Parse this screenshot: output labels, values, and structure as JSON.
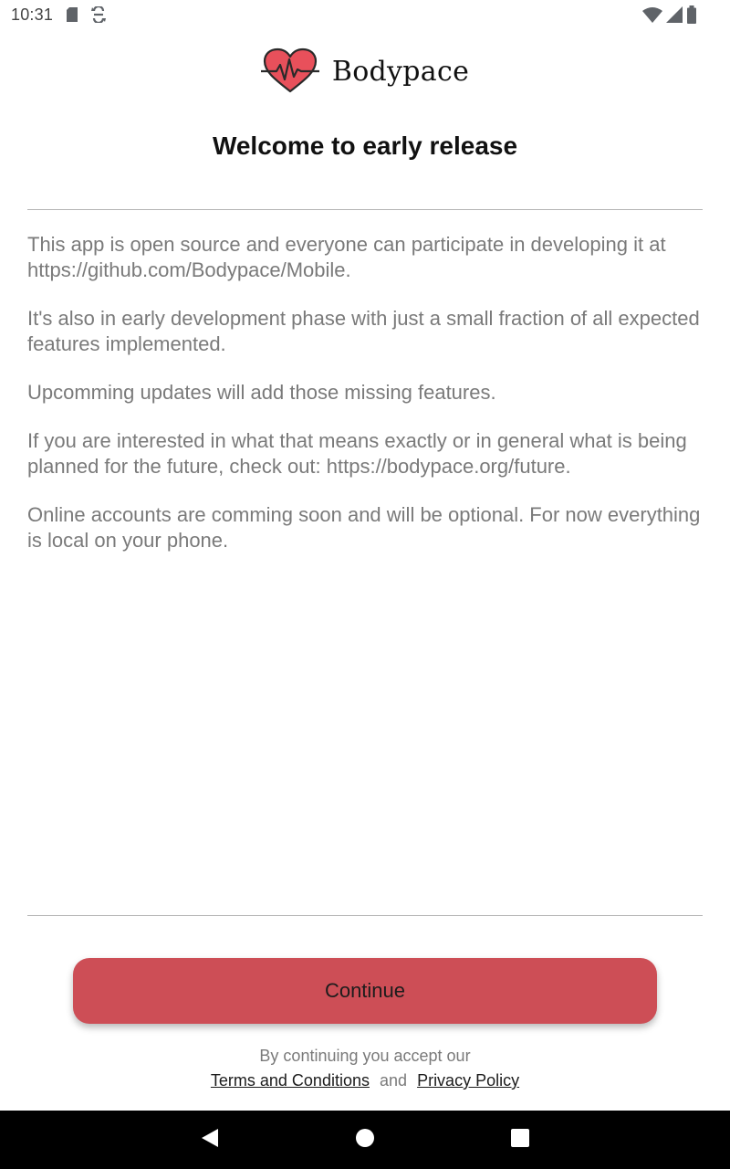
{
  "status_bar": {
    "time": "10:31",
    "icons_left": [
      "sd-card-icon",
      "sync-icon"
    ],
    "icons_right": [
      "wifi-icon",
      "signal-icon",
      "battery-icon"
    ]
  },
  "brand": {
    "name": "Bodypace",
    "logo_icon": "heart-pulse-icon",
    "logo_color": "#e8505b"
  },
  "page": {
    "title": "Welcome to early release",
    "paragraphs": [
      "This app is open source and everyone can participate in developing it at https://github.com/Bodypace/Mobile.",
      "It's also in early development phase with just a small fraction of all expected features implemented.",
      "Upcomming updates will add those missing features.",
      "If you are interested in what that means exactly or in general what is being planned for the future, check out: https://bodypace.org/future.",
      "Online accounts are comming soon and will be optional. For now everything is local on your phone."
    ]
  },
  "actions": {
    "continue_label": "Continue",
    "continue_color": "#cd4e56"
  },
  "legal": {
    "prefix": "By continuing you accept our",
    "terms_label": "Terms and Conditions",
    "and_label": "and",
    "privacy_label": "Privacy Policy"
  },
  "nav_bar": {
    "buttons": [
      "back-icon",
      "home-icon",
      "recents-icon"
    ]
  }
}
